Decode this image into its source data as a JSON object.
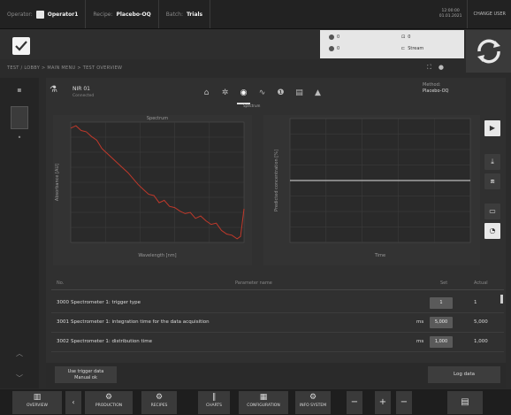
{
  "topbar": {
    "operator_label": "Operator:",
    "operator_value": "Operator1",
    "recipe_label": "Recipe:",
    "recipe_value": "Placebo-OQ",
    "batch_label": "Batch:",
    "batch_value": "Trials",
    "time_line1": "12:00:00",
    "time_line2": "01.01.2021",
    "change_label": "CHANGE USER"
  },
  "status_panel": {
    "ind1": "0",
    "ind2": "0",
    "ind3": "0",
    "ind4": "Stream"
  },
  "breadcrumb": {
    "text": "TEST / LOBBY > MAIN MENU > TEST OVERVIEW"
  },
  "device": {
    "name": "NIR 01",
    "sub": "Connected",
    "method_label": "Method:",
    "method_value": "Placebo-OQ",
    "active_tab_label": "Spectrum"
  },
  "tabs": [
    {
      "icon": "home-icon",
      "glyph": "⌂"
    },
    {
      "icon": "settings-icon",
      "glyph": "✲"
    },
    {
      "icon": "spectrum-icon",
      "glyph": "◉"
    },
    {
      "icon": "chart-icon",
      "glyph": "∿"
    },
    {
      "icon": "info-icon",
      "glyph": "❶"
    },
    {
      "icon": "document-icon",
      "glyph": "▤"
    },
    {
      "icon": "warning-icon",
      "glyph": "▲"
    }
  ],
  "chart_data": [
    {
      "type": "line",
      "title": "Spectrum",
      "xlabel": "Wavelength [nm]",
      "ylabel": "Absorbance [AU]",
      "grid": true,
      "series": [
        {
          "color": "#c0392b",
          "x": [
            0,
            0.03,
            0.06,
            0.09,
            0.12,
            0.15,
            0.18,
            0.21,
            0.24,
            0.27,
            0.3,
            0.33,
            0.36,
            0.39,
            0.42,
            0.45,
            0.48,
            0.51,
            0.54,
            0.57,
            0.6,
            0.63,
            0.66,
            0.69,
            0.72,
            0.75,
            0.78,
            0.81,
            0.84,
            0.87,
            0.9,
            0.93,
            0.96,
            0.98,
            1.0
          ],
          "y": [
            0.95,
            0.97,
            0.93,
            0.92,
            0.88,
            0.85,
            0.78,
            0.74,
            0.7,
            0.66,
            0.62,
            0.58,
            0.53,
            0.48,
            0.44,
            0.4,
            0.39,
            0.33,
            0.35,
            0.3,
            0.29,
            0.26,
            0.24,
            0.25,
            0.2,
            0.22,
            0.18,
            0.15,
            0.16,
            0.1,
            0.07,
            0.06,
            0.03,
            0.05,
            0.28
          ]
        }
      ]
    },
    {
      "type": "line",
      "title": "",
      "xlabel": "Time",
      "ylabel": "Predicted concentration [%]",
      "grid": true,
      "series": [
        {
          "color": "#dddddd",
          "x": [
            0,
            1
          ],
          "y": [
            0.5,
            0.5
          ]
        }
      ]
    }
  ],
  "side_tools": [
    {
      "icon": "play-icon",
      "glyph": "▶"
    },
    {
      "icon": "download-icon",
      "glyph": "⤓"
    },
    {
      "icon": "crop-icon",
      "glyph": "⧈"
    },
    {
      "icon": "image-icon",
      "glyph": "▭"
    },
    {
      "icon": "timer-icon",
      "glyph": "◔"
    }
  ],
  "table": {
    "col_no": "No.",
    "col_name": "Parameter name",
    "col_set": "Set",
    "col_actual": "Actual",
    "rows": [
      {
        "no": "3000",
        "name": "Spectrometer 1: trigger type",
        "unit": "",
        "set": "1",
        "actual": "1"
      },
      {
        "no": "3001",
        "name": "Spectrometer 1: integration time for the data acquisition",
        "unit": "ms",
        "set": "5,000",
        "actual": "5,000"
      },
      {
        "no": "3002",
        "name": "Spectrometer 1: distribution time",
        "unit": "ms",
        "set": "1,000",
        "actual": "1,000"
      }
    ]
  },
  "footer": {
    "trigger_line1": "Use trigger data",
    "trigger_line2": "Manual ok",
    "log_button": "Log data"
  },
  "nav": [
    {
      "label": "OVERVIEW",
      "glyph": "▥"
    },
    {
      "label": "PRODUCTION",
      "glyph": "⚙"
    },
    {
      "label": "RECIPES",
      "glyph": "⚙"
    },
    {
      "label": "CHARTS",
      "glyph": "∥"
    },
    {
      "label": "CONFIGURATION",
      "glyph": "▦"
    },
    {
      "label": "INFO SYSTEM",
      "glyph": "⚙"
    }
  ]
}
